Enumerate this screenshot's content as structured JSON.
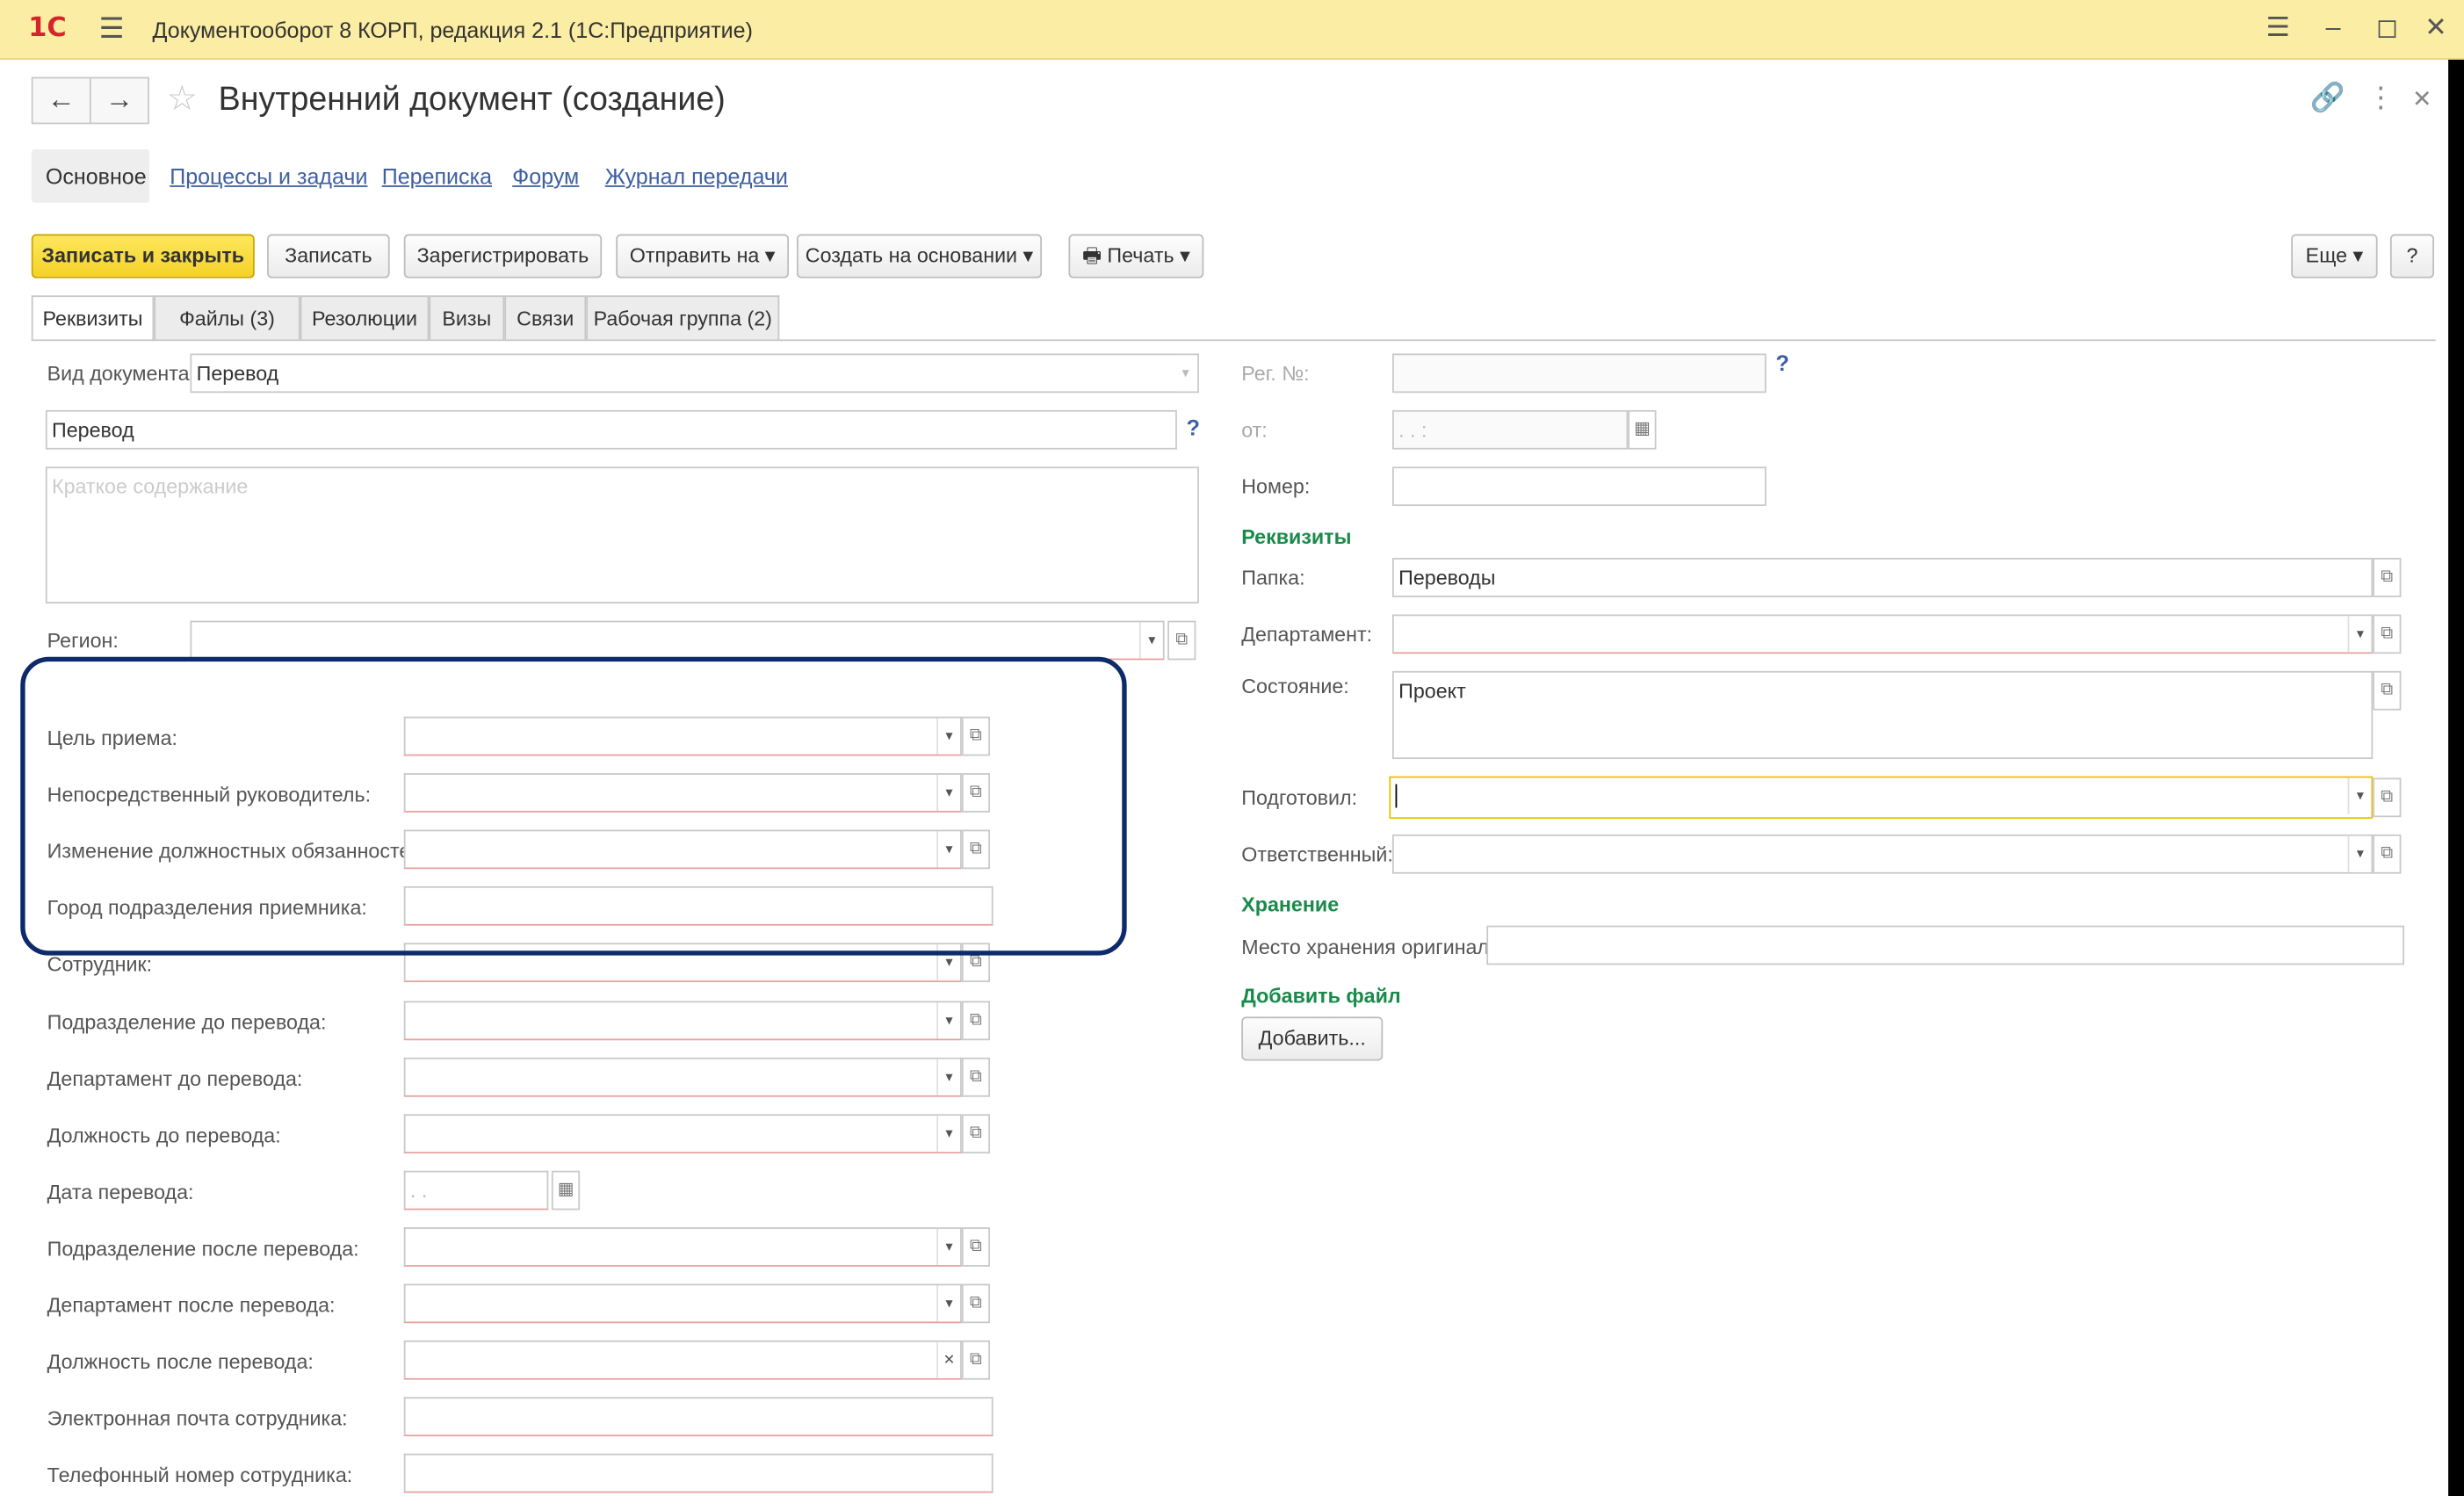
{
  "titlebar": {
    "logo": "1С",
    "title": "Документооборот 8 КОРП, редакция 2.1  (1С:Предприятие)"
  },
  "header": {
    "doc_title": "Внутренний документ (создание)"
  },
  "nav_tabs": [
    "Основное",
    "Процессы и задачи",
    "Переписка",
    "Форум",
    "Журнал передачи"
  ],
  "toolbar": {
    "save_close": "Записать и закрыть",
    "save": "Записать",
    "register": "Зарегистрировать",
    "send": "Отправить на",
    "create_based": "Создать на основании",
    "print": "Печать",
    "more": "Еще",
    "help": "?"
  },
  "sub_tabs": [
    "Реквизиты",
    "Файлы (3)",
    "Резолюции",
    "Визы",
    "Связи",
    "Рабочая группа (2)"
  ],
  "left": {
    "doc_type_label": "Вид документа:",
    "doc_type_value": "Перевод",
    "title_value": "Перевод",
    "summary_placeholder": "Краткое содержание",
    "region_label": "Регион:",
    "fields": [
      {
        "label": "Цель приема:"
      },
      {
        "label": "Непосредственный руководитель:"
      },
      {
        "label": "Изменение должностных обязанностей:"
      },
      {
        "label": "Город подразделения приемника:"
      },
      {
        "label": "Сотрудник:"
      },
      {
        "label": "Подразделение до перевода:"
      },
      {
        "label": "Департамент до перевода:"
      },
      {
        "label": "Должность до перевода:"
      },
      {
        "label": "Дата перевода:",
        "value": " .  .    "
      },
      {
        "label": "Подразделение после перевода:"
      },
      {
        "label": "Департамент после перевода:"
      },
      {
        "label": "Должность после перевода:"
      },
      {
        "label": "Электронная почта сотрудника:"
      },
      {
        "label": "Телефонный номер сотрудника:"
      }
    ]
  },
  "right": {
    "reg_no_label": "Рег. №:",
    "from_label": "от:",
    "from_value": " .  .       :  ",
    "number_label": "Номер:",
    "section_requisites": "Реквизиты",
    "folder_label": "Папка:",
    "folder_value": "Переводы",
    "department_label": "Департамент:",
    "state_label": "Состояние:",
    "state_value": "Проект",
    "prepared_label": "Подготовил:",
    "responsible_label": "Ответственный:",
    "section_storage": "Хранение",
    "storage_label": "Место хранения оригинала:",
    "section_add_file": "Добавить файл",
    "add_button": "Добавить..."
  },
  "colors": {
    "titlebar_bg": "#fbeda3",
    "primary_button": "#f5d22a",
    "link": "#3e5fa3",
    "section": "#1a8a4b",
    "highlight_border": "#0d2a6b"
  }
}
